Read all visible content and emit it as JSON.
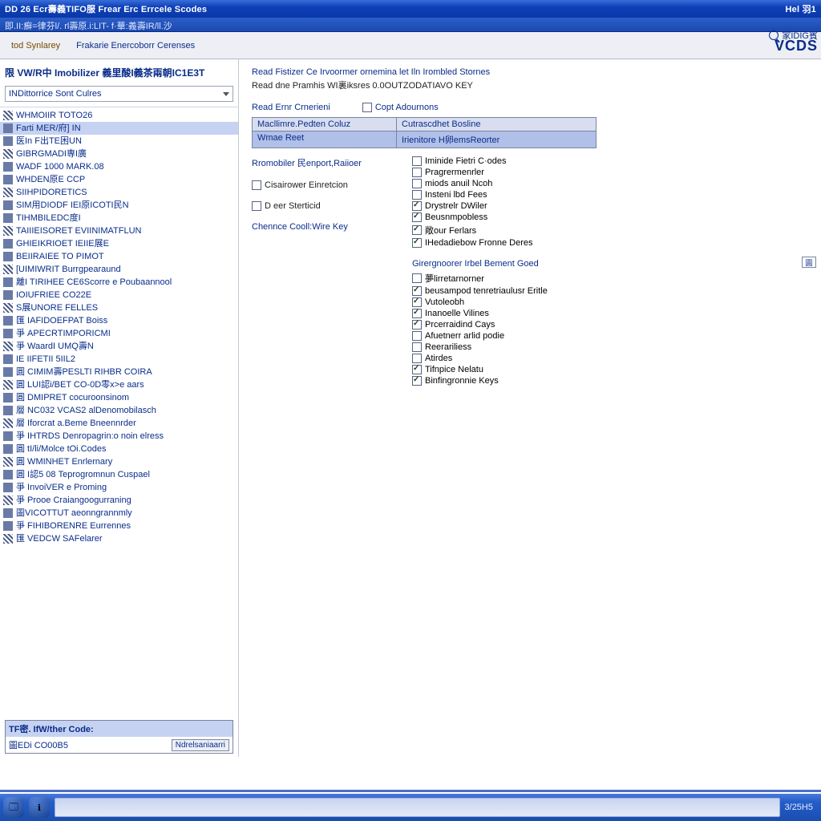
{
  "titlebar": {
    "text": "DD 26 Ecr壽義TIFO服 Frear Erc Errcele Scodes",
    "help": "Hel 羽1"
  },
  "subbar": {
    "text": "即.II:癬=律芬l/. rl壽原.i:LIT- f·華:義壽IR/ll.沙"
  },
  "toolbar": {
    "tab1": "tod Synlarey",
    "tab2": "Frakarie Enercoborr Cerenses",
    "brand": "VCDS"
  },
  "search": {
    "label": "家IDIG賓"
  },
  "sidebar": {
    "header": "限 VW/R中 Imobilizer 義里酸I義茶兩朝IC1E3T",
    "dropdown": "INDittorrice Sont Culres",
    "items": [
      "WHMOIIR TOTO26",
      "Farti MER/府] IN",
      "医In F出TE困UN",
      "GIBRGMADI専I廣",
      "WADF 1000 MARK.08",
      "WHDEN原E CCP",
      "SIIHPIDORETICS",
      "SIM用DIODF IEI原ICOTI民N",
      "TIHMBILEDC度I",
      "TAIIIEISORET EVIINIMATFLUN",
      "GHIEIKRIOET IEIIE展E",
      "BEIIRAIEE TO PIMOT",
      "[UIMIWRIT Burrgpearaund",
      "離I TIRIHEE CE6Scorre e Poubaannool",
      "IOIUFRIEE CO22E",
      "S展UNORE FELLES",
      "匯 IAFIDOEFPAT Boiss",
      "爭 APECRTIMPORICMI",
      "爭 WaardI UMQ壽N",
      "IE IIFETII 5IIL2",
      "圓 CIMIM壽PESLTI RIHBR COIRA",
      "圓 LUI認i/BET CO-0D零x>e aars",
      "圓 DMIPRET cocuroonsinom",
      "層 NC032 VCAS2 alDenomobilasch",
      "層 Iforcrat a.Beme Bneennrder",
      "爭 IHTRDS Denropagrin:o noin elress",
      "圓 tI/li/Molce tOi.Codes",
      "圓 WMINHET Enrlernary",
      "圓 I認5 08 Teprogromnun Cuspael",
      "爭 InvoiVER e Proming",
      "爭 Prooe Craiangoogurraning",
      "圖VICOTTUT aeonngrannmly",
      "爭 FIHIBORENRE Eurrennes",
      "匯 VEDCW SAFelarer"
    ],
    "codepanel": {
      "head": "TF密. IfW/ther Code:",
      "label": "圖EDi CO00B5",
      "btn": "Ndrelsaniaarri"
    }
  },
  "main": {
    "desc1": "Read Fistizer Ce Irvoormer ornemina let Iln Irombled Stornes",
    "desc2": "Read dne Pramhis WI裏iksres 0.0OUTZODATIAVO KEY",
    "rowhead": {
      "label": "Read Ernr Crnerieni",
      "chk": "Copt Adournons"
    },
    "grid": {
      "r1l": "Macllimre.Pedten Coluz",
      "r1r": "Cutrascdhet Bosline",
      "r2l": "Wmae Reet",
      "r2r": "Irienitore H卵emsReorter"
    },
    "lcol": {
      "i1": "Rromobiler 民enport,Raiioer",
      "i2": "Cisairower Einretcion",
      "i3": "D eer Sterticid",
      "i4": "Chennce Cooll:Wire Key"
    },
    "rcol": {
      "items": [
        {
          "t": "Iminide Fietri C·odes",
          "c": false
        },
        {
          "t": "Pragrermenrler",
          "c": false
        },
        {
          "t": "miods anuil Ncoh",
          "c": false
        },
        {
          "t": "Insteni lbd Fees",
          "c": false
        },
        {
          "t": "Drystrelr DWiler",
          "c": true
        },
        {
          "t": "Beusnmpobless",
          "c": true
        },
        {
          "t": "敞our Ferlars",
          "c": true
        },
        {
          "t": "IHedadiebow Fronne Deres",
          "c": true
        }
      ],
      "subhead": "Girergnoorer Irbel Bement Goed",
      "sub": [
        {
          "t": "夢lirretarnorner",
          "c": false
        },
        {
          "t": "beusampod tenretriaulusr Eritle",
          "c": true
        },
        {
          "t": "Vutoleobh",
          "c": true
        },
        {
          "t": "Inanoelle Vilines",
          "c": true
        },
        {
          "t": "Prcerraidind Cays",
          "c": true
        },
        {
          "t": "Afuetnerr arlid podie",
          "c": false
        },
        {
          "t": "Reerariliess",
          "c": false
        },
        {
          "t": "Atirdes",
          "c": false
        },
        {
          "t": "Tifnpice Nelatu",
          "c": true
        },
        {
          "t": "Binfingronnie Keys",
          "c": true
        }
      ]
    },
    "hint": "圓"
  },
  "taskbar": {
    "clock": "3/25H5"
  }
}
